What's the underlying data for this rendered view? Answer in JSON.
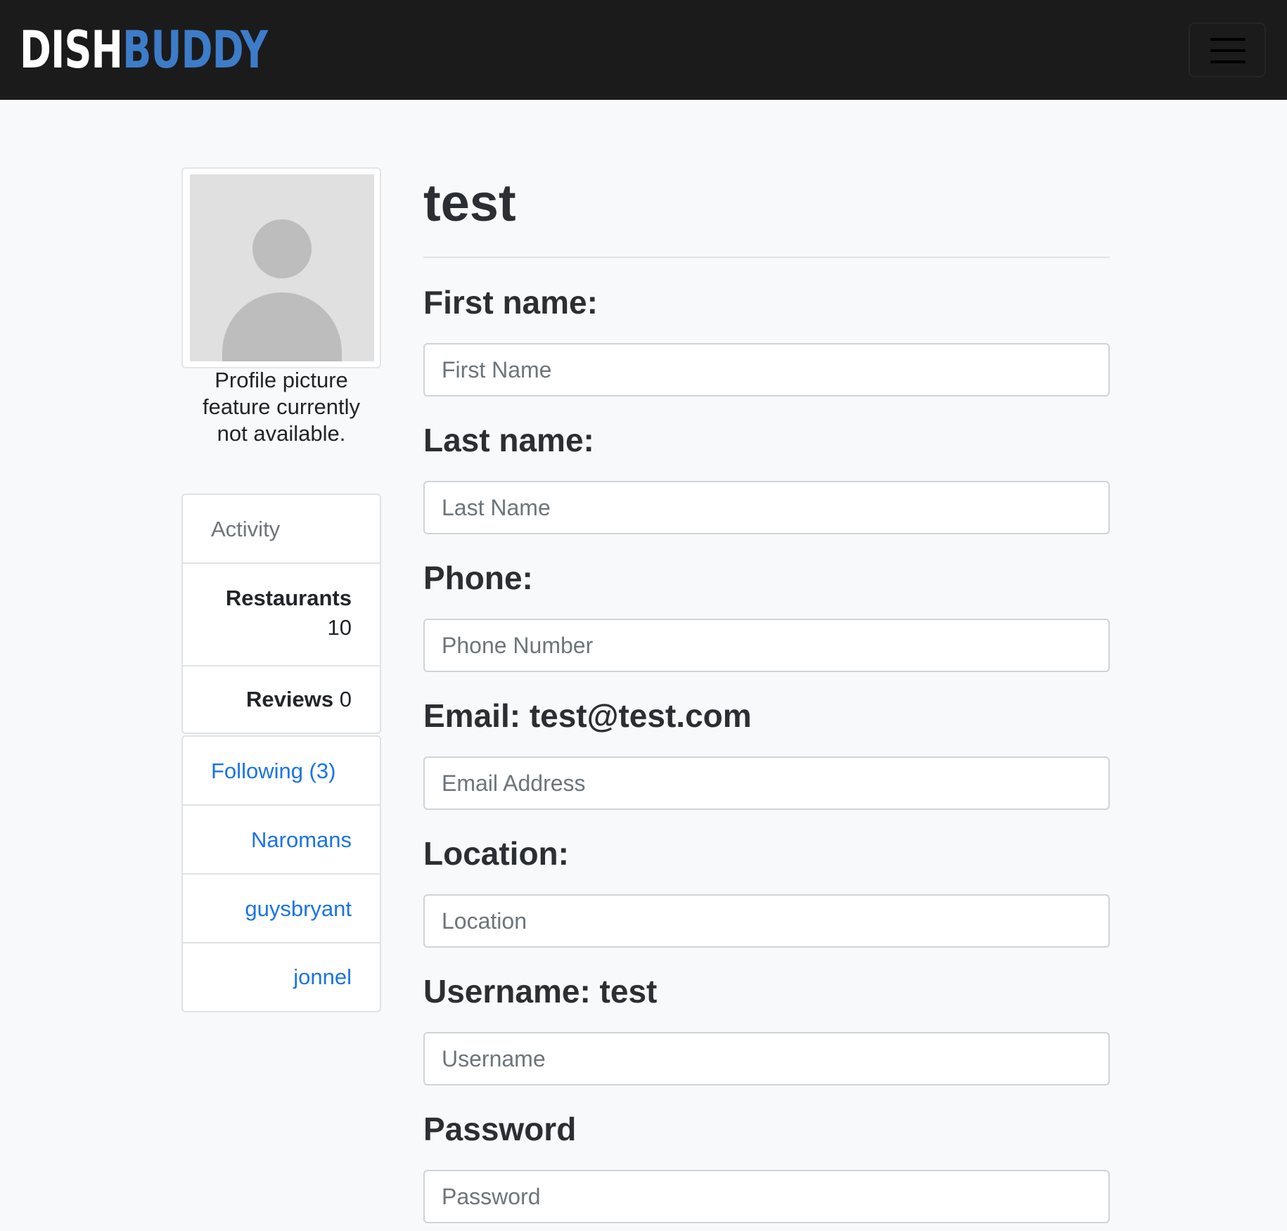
{
  "navbar": {
    "brand_part1": "DISH",
    "brand_part2": "BUDDY",
    "brand_colors": {
      "dish": "#ffffff",
      "buddy": "#3d7cc9"
    },
    "menu_icon": "hamburger-menu-icon"
  },
  "profile": {
    "avatar_icon": "user-placeholder-icon",
    "caption_line1": "Profile picture",
    "caption_line2": "feature currently",
    "caption_line3": "not available."
  },
  "activity": {
    "header": "Activity",
    "restaurants_label": "Restaurants",
    "restaurants_count": "10",
    "reviews_label": "Reviews",
    "reviews_count": "0"
  },
  "following": {
    "header": "Following (3)",
    "users": [
      "Naromans",
      "guysbryant",
      "jonnel"
    ]
  },
  "form": {
    "title": "test",
    "first_name_label": "First name:",
    "first_name_placeholder": "First Name",
    "last_name_label": "Last name:",
    "last_name_placeholder": "Last Name",
    "phone_label": "Phone:",
    "phone_placeholder": "Phone Number",
    "email_label": "Email: test@test.com",
    "email_placeholder": "Email Address",
    "location_label": "Location:",
    "location_placeholder": "Location",
    "username_label": "Username: test",
    "username_placeholder": "Username",
    "password_label": "Password",
    "password_placeholder": "Password"
  },
  "colors": {
    "link": "#1a73e8",
    "navbar_bg": "#1b1b1c",
    "page_bg": "#f8f9fa"
  }
}
